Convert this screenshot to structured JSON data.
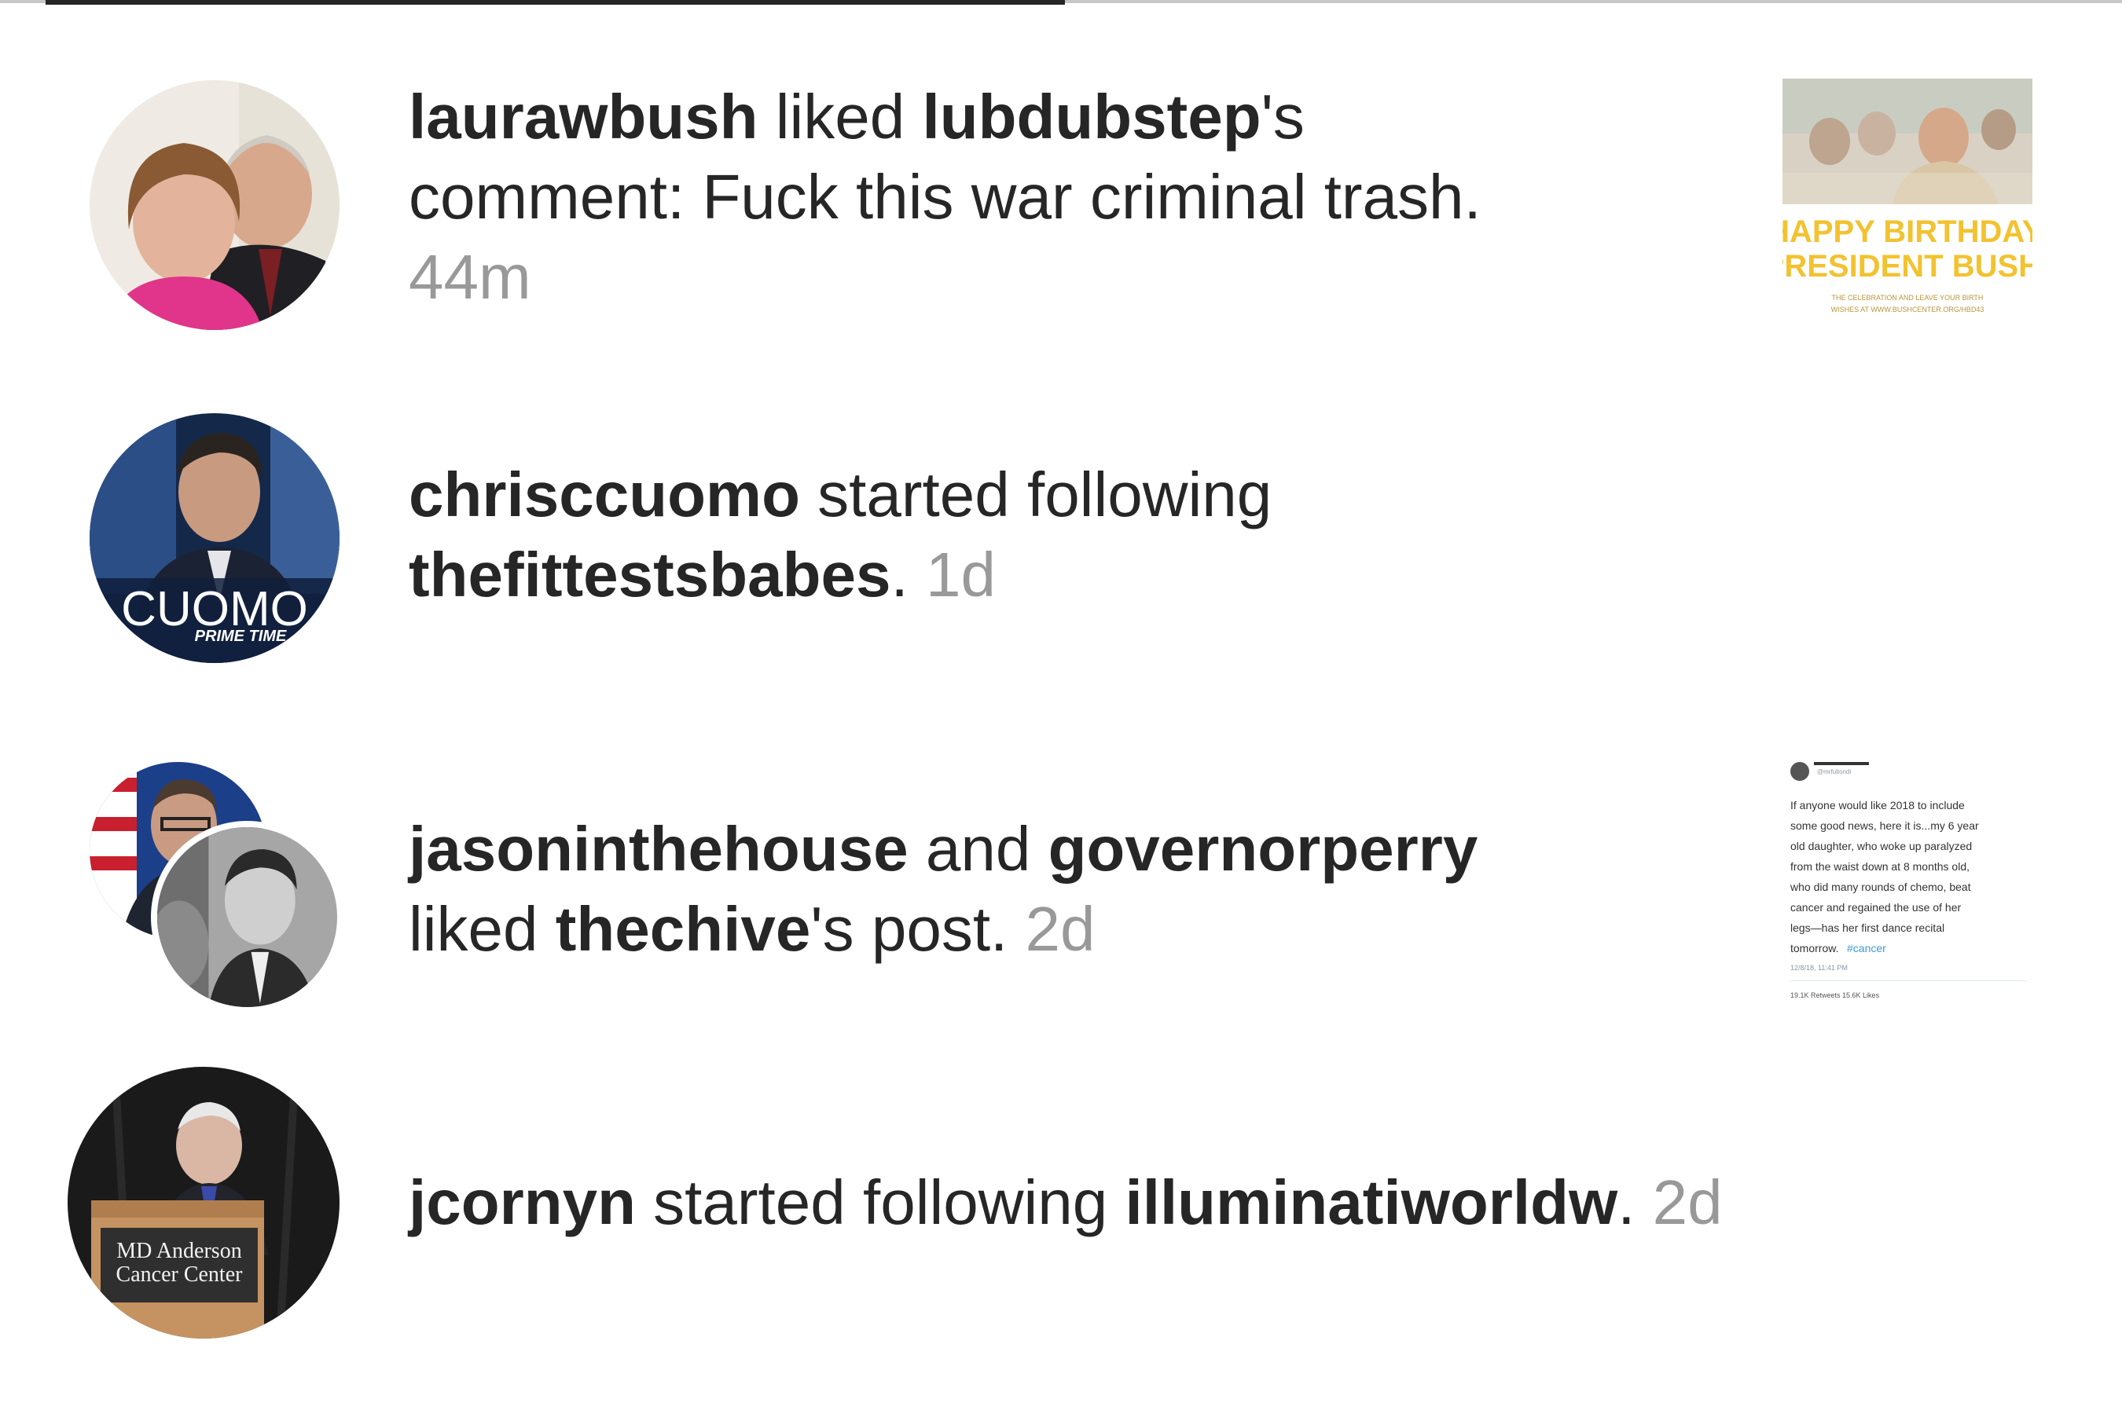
{
  "notifications": [
    {
      "actor": "laurawbush",
      "action": " liked ",
      "target": "lubdubstep",
      "suffix": "'s comment: Fuck this war criminal trash.",
      "time": "44m",
      "thumbnail": {
        "headline_1": "HAPPY BIRTHDAY,",
        "headline_2": "PRESIDENT BUSH!",
        "small_1": "THE CELEBRATION AND LEAVE YOUR BIRTH",
        "small_2": "WISHES AT WWW.BUSHCENTER.ORG/HBD43"
      }
    },
    {
      "actor": "chrisccuomo",
      "action": " started following ",
      "target": "thefittestsbabes",
      "suffix": ".",
      "time": "1d",
      "avatar_text_1": "CUOMO",
      "avatar_text_2": "PRIME TIME"
    },
    {
      "actor": "jasoninthehouse",
      "conjunction": " and ",
      "actor2": "governorperry",
      "action": " liked ",
      "target": "thechive",
      "suffix": "'s post.",
      "time": "2d",
      "thumbnail": {
        "handle": "@mrfultondi",
        "lines": [
          "If anyone would like 2018 to include",
          "some good news, here it is...my 6 year",
          "old daughter, who woke up paralyzed",
          "from the waist down at 8 months old,",
          "who did many rounds of chemo, beat",
          "cancer and regained the use of her",
          "legs—has her first dance recital",
          "tomorrow."
        ],
        "hashtag": "#cancer",
        "date": "12/8/18, 11:41 PM",
        "stats": "19.1K Retweets  15.6K Likes"
      }
    },
    {
      "actor": "jcornyn",
      "action": " started following ",
      "target": "illuminatiworldw",
      "suffix": ".",
      "time": "2d",
      "avatar_text_1": "MD Anderson",
      "avatar_text_2": "Cancer Center"
    }
  ],
  "colors": {
    "text": "#262626",
    "timestamp": "#999999",
    "tab_active": "#262626",
    "tab_inactive": "#c7c7c7",
    "birthday_yellow": "#f2c230",
    "link_blue": "#3d9bd8"
  }
}
